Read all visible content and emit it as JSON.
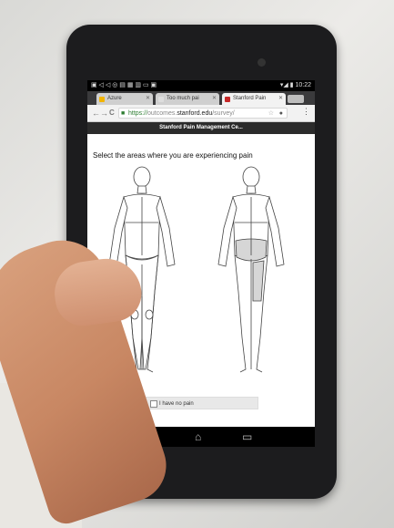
{
  "status": {
    "left_icons": "▣ ◁ ◁ ◎ ▤ ▦ ▥ ▭ ▣",
    "right_text": "▾◢ ▮ 10:22"
  },
  "tabs": [
    {
      "label": "Azure",
      "icon_color": "#f2b400"
    },
    {
      "label": "Too much pai",
      "icon_color": "#dddddd"
    },
    {
      "label": "Stanford Pain",
      "icon_color": "#c62828"
    }
  ],
  "toolbar": {
    "back_icon": "←",
    "forward_icon": "→",
    "reload_icon": "C"
  },
  "omnibox": {
    "scheme": "https://",
    "subdomain": "outcomes.",
    "host": "stanford.edu",
    "path": "/survey/"
  },
  "page_header": "Stanford Pain Management Ce...",
  "prompt": "Select the areas where you are experiencing pain",
  "no_pain_label": "I have no pain",
  "nav": {
    "back_icon": "↩",
    "home_icon": "⌂",
    "recents_icon": "▭"
  }
}
